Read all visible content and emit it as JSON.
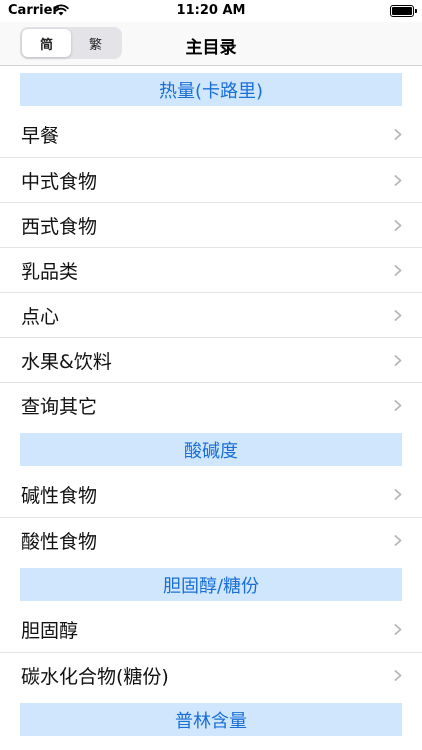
{
  "status_bar": {
    "carrier": "Carrier",
    "time": "11:20 AM"
  },
  "nav": {
    "title": "主目录",
    "segments": [
      "简",
      "繁"
    ],
    "selected_segment": "简"
  },
  "sections": [
    {
      "header": "热量(卡路里)",
      "items": [
        "早餐",
        "中式食物",
        "西式食物",
        "乳品类",
        "点心",
        "水果&饮料",
        "查询其它"
      ]
    },
    {
      "header": "酸碱度",
      "items": [
        "碱性食物",
        "酸性食物"
      ]
    },
    {
      "header": "胆固醇/糖份",
      "items": [
        "胆固醇",
        "碳水化合物(糖份)"
      ]
    },
    {
      "header": "普林含量",
      "items": []
    }
  ],
  "colors": {
    "section_header_bg": "#cfe6fc",
    "section_header_text": "#1a6fd6"
  },
  "icons": {
    "row_accessory": "chevron-right-icon",
    "wifi": "wifi-icon",
    "battery": "battery-icon"
  }
}
